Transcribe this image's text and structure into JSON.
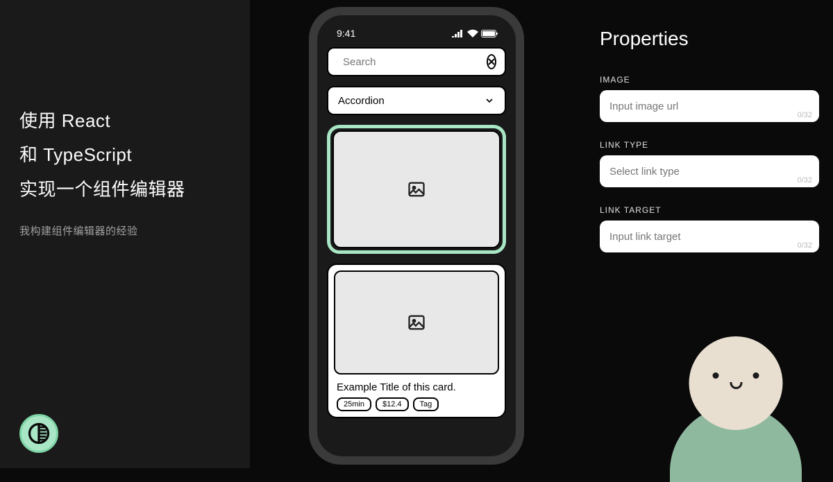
{
  "left": {
    "headline_l1": "使用 React",
    "headline_l2": "和 TypeScript",
    "headline_l3": "实现一个组件编辑器",
    "subhead": "我构建组件编辑器的经验"
  },
  "phone": {
    "time": "9:41",
    "search_placeholder": "Search",
    "accordion_label": "Accordion",
    "card_title": "Example Title of this card.",
    "chips": [
      "25min",
      "$12.4",
      "Tag"
    ]
  },
  "props": {
    "title": "Properties",
    "fields": [
      {
        "label": "IMAGE",
        "placeholder": "Input image url",
        "counter": "0/32"
      },
      {
        "label": "LINK TYPE",
        "placeholder": "Select link type",
        "counter": "0/32"
      },
      {
        "label": "LINK TARGET",
        "placeholder": "Input link target",
        "counter": "0/32"
      }
    ]
  }
}
